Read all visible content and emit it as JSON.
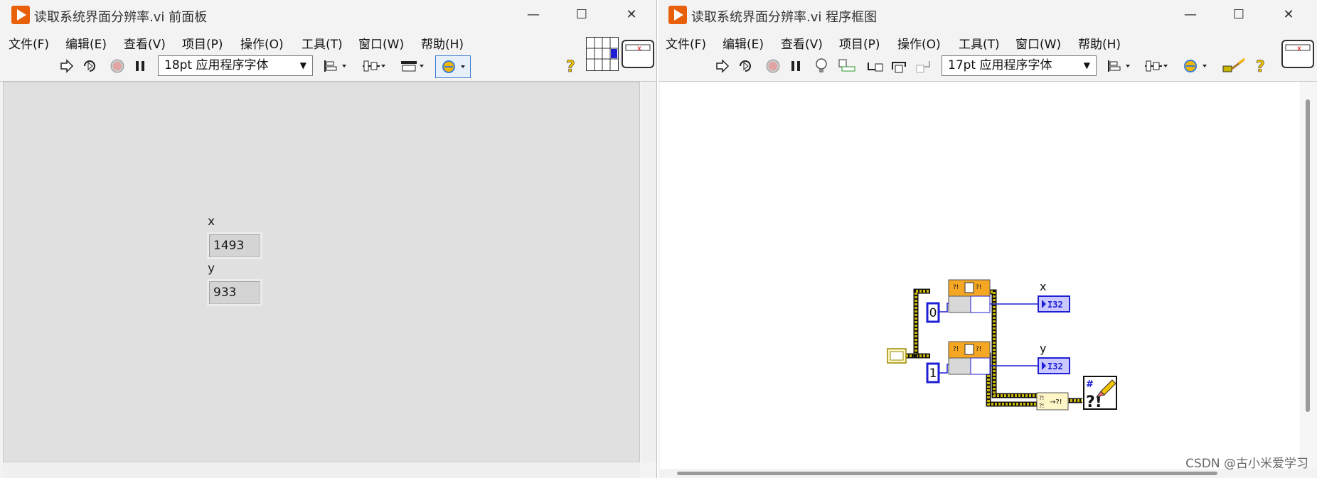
{
  "front_panel": {
    "title": "读取系统界面分辨率.vi 前面板",
    "window_controls": {
      "minimize": "—",
      "maximize": "☐",
      "close": "✕"
    },
    "menu": [
      "文件(F)",
      "编辑(E)",
      "查看(V)",
      "项目(P)",
      "操作(O)",
      "工具(T)",
      "窗口(W)",
      "帮助(H)"
    ],
    "font_select": "18pt 应用程序字体",
    "indicators": [
      {
        "label": "x",
        "value": "1493"
      },
      {
        "label": "y",
        "value": "933"
      }
    ]
  },
  "block_diagram": {
    "title": "读取系统界面分辨率.vi 程序框图",
    "window_controls": {
      "minimize": "—",
      "maximize": "☐",
      "close": "✕"
    },
    "menu": [
      "文件(F)",
      "编辑(E)",
      "查看(V)",
      "项目(P)",
      "操作(O)",
      "工具(T)",
      "窗口(W)",
      "帮助(H)"
    ],
    "font_select": "17pt 应用程序字体",
    "constants": [
      "0",
      "1"
    ],
    "terminal_labels": [
      "x",
      "y"
    ],
    "terminal_type": "I32",
    "node_glyph": "?!",
    "convert_glyph": "→?!",
    "error_glyph": "#"
  },
  "watermark": "CSDN @古小米爱学习",
  "colors": {
    "app_icon": "#e9600b",
    "wire_cluster": "#c9b600",
    "wire_int": "#1f1fd6",
    "node_orange": "#f5a623",
    "terminal_fill": "#c9c9ff"
  }
}
